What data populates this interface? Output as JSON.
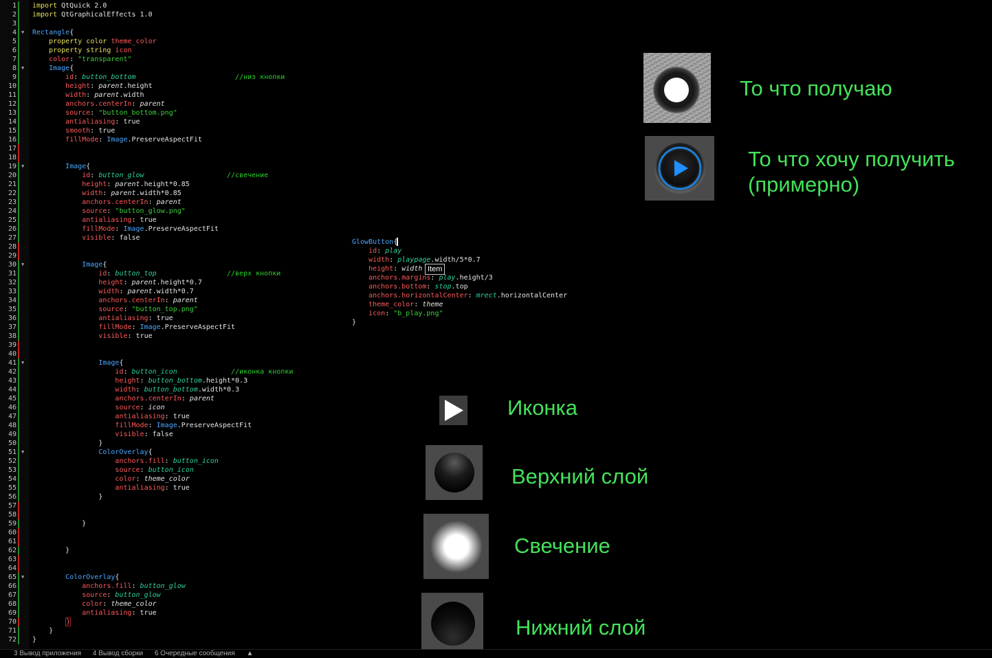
{
  "editor": {
    "line_numbers": [
      "1",
      "2",
      "3",
      "4",
      "5",
      "6",
      "7",
      "8",
      "9",
      "10",
      "11",
      "12",
      "13",
      "14",
      "15",
      "16",
      "17",
      "18",
      "19",
      "20",
      "21",
      "22",
      "23",
      "24",
      "25",
      "26",
      "27",
      "28",
      "29",
      "30",
      "31",
      "32",
      "33",
      "34",
      "35",
      "36",
      "37",
      "38",
      "39",
      "40",
      "41",
      "42",
      "43",
      "44",
      "45",
      "46",
      "47",
      "48",
      "49",
      "50",
      "51",
      "52",
      "53",
      "54",
      "55",
      "56",
      "57",
      "58",
      "59",
      "60",
      "61",
      "62",
      "63",
      "64",
      "65",
      "66",
      "67",
      "68",
      "69",
      "70",
      "71",
      "72"
    ]
  },
  "tooltip": "Item",
  "annotations": {
    "got": "То что получаю",
    "want_line1": "То что хочу получить",
    "want_line2": "(примерно)",
    "icon": "Иконка",
    "top_layer": "Верхний слой",
    "glow": "Свечение",
    "bottom_layer": "Нижний слой"
  },
  "bottom_tabs": [
    "3  Вывод приложения",
    "4  Вывод сборки",
    "6  Очередные сообщения"
  ],
  "colors": {
    "label_green": "#43e25a",
    "keyword": "#e8e060",
    "type": "#4aa8ff",
    "property": "#ff5a5a",
    "string": "#3ed13e",
    "comment": "#2bd22b"
  },
  "icons": {
    "play": "play-icon",
    "fold": "fold-arrow-icon"
  }
}
